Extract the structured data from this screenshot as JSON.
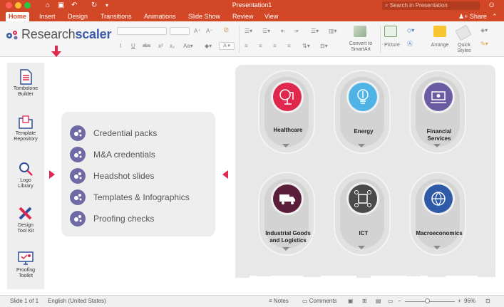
{
  "window": {
    "title": "Presentation1",
    "search_placeholder": "Search in Presentation"
  },
  "ribbon": {
    "tabs": [
      "Home",
      "Insert",
      "Design",
      "Transitions",
      "Animations",
      "Slide Show",
      "Review",
      "View"
    ],
    "active_tab": "Home",
    "share_label": "Share",
    "convert_label_1": "Convert to",
    "convert_label_2": "SmartArt",
    "picture_label": "Picture",
    "arrange_label": "Arrange",
    "quick_styles_1": "Quick",
    "quick_styles_2": "Styles"
  },
  "addin": {
    "brand_part1": "Research",
    "brand_part2": "scaler"
  },
  "sidebar": {
    "items": [
      {
        "line1": "Tombstone",
        "line2": "Builder",
        "icon": "document-icon"
      },
      {
        "line1": "Template",
        "line2": "Repository",
        "icon": "folder-icon"
      },
      {
        "line1": "Logo",
        "line2": "Library",
        "icon": "magnifier-icon"
      },
      {
        "line1": "Design",
        "line2": "Tool Kit",
        "icon": "pencil-ruler-icon"
      },
      {
        "line1": "Proofing",
        "line2": "Toolkit",
        "icon": "monitor-check-icon"
      }
    ]
  },
  "menu": {
    "items": [
      "Credential packs",
      "M&A credentials",
      "Headshot slides",
      "Templates & Infographics",
      "Proofing checks"
    ]
  },
  "sectors": [
    {
      "line1": "Healthcare",
      "line2": "",
      "color": "#e0284f",
      "icon": "healthcare-icon"
    },
    {
      "line1": "Energy",
      "line2": "",
      "color": "#4fb3e6",
      "icon": "energy-icon"
    },
    {
      "line1": "Financial",
      "line2": "Services",
      "color": "#6a5ba3",
      "icon": "financial-icon"
    },
    {
      "line1": "Industrial Goods",
      "line2": "and Logistics",
      "color": "#5a1e3a",
      "icon": "truck-icon"
    },
    {
      "line1": "ICT",
      "line2": "",
      "color": "#4a4a4a",
      "icon": "ict-icon"
    },
    {
      "line1": "Macroeconomics",
      "line2": "",
      "color": "#2e5aa8",
      "icon": "globe-icon"
    }
  ],
  "statusbar": {
    "slide": "Slide 1 of 1",
    "language": "English (United States)",
    "notes": "Notes",
    "comments": "Comments",
    "zoom": "96%"
  },
  "colors": {
    "ribbon_red": "#d24726",
    "brand_blue": "#3a5aa8",
    "menu_purple": "#6f6aa6",
    "accent_red": "#e0284f"
  }
}
